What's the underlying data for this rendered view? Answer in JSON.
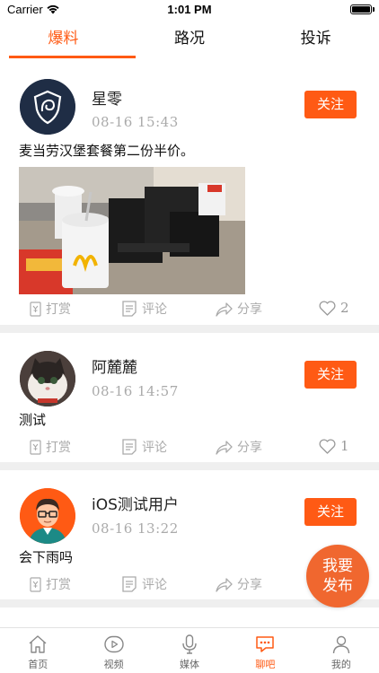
{
  "status_bar": {
    "carrier": "Carrier",
    "time": "1:01 PM"
  },
  "top_tabs": [
    {
      "label": "爆料",
      "active": true
    },
    {
      "label": "路况",
      "active": false
    },
    {
      "label": "投诉",
      "active": false
    }
  ],
  "posts": [
    {
      "username": "星零",
      "timestamp": "08-16  15:43",
      "follow_label": "关注",
      "text": "麦当劳汉堡套餐第二份半价。",
      "has_image": true,
      "actions": {
        "reward": "打赏",
        "comment": "评论",
        "share": "分享",
        "likes": "2"
      }
    },
    {
      "username": "阿麓麓",
      "timestamp": "08-16  14:57",
      "follow_label": "关注",
      "text": "测试",
      "has_image": false,
      "actions": {
        "reward": "打赏",
        "comment": "评论",
        "share": "分享",
        "likes": "1"
      }
    },
    {
      "username": "iOS测试用户",
      "timestamp": "08-16  13:22",
      "follow_label": "关注",
      "text": "会下雨吗",
      "has_image": false,
      "actions": {
        "reward": "打赏",
        "comment": "评论",
        "share": "分享",
        "likes": ""
      }
    }
  ],
  "fab": {
    "line1": "我要",
    "line2": "发布"
  },
  "bottom_tabs": [
    {
      "label": "首页",
      "icon": "home-icon",
      "active": false
    },
    {
      "label": "视频",
      "icon": "video-icon",
      "active": false
    },
    {
      "label": "媒体",
      "icon": "microphone-icon",
      "active": false
    },
    {
      "label": "聊吧",
      "icon": "chat-icon",
      "active": true
    },
    {
      "label": "我的",
      "icon": "profile-icon",
      "active": false
    }
  ],
  "colors": {
    "accent": "#ff5a14",
    "divider": "#efefef",
    "muted_text": "#aaaaaa"
  }
}
